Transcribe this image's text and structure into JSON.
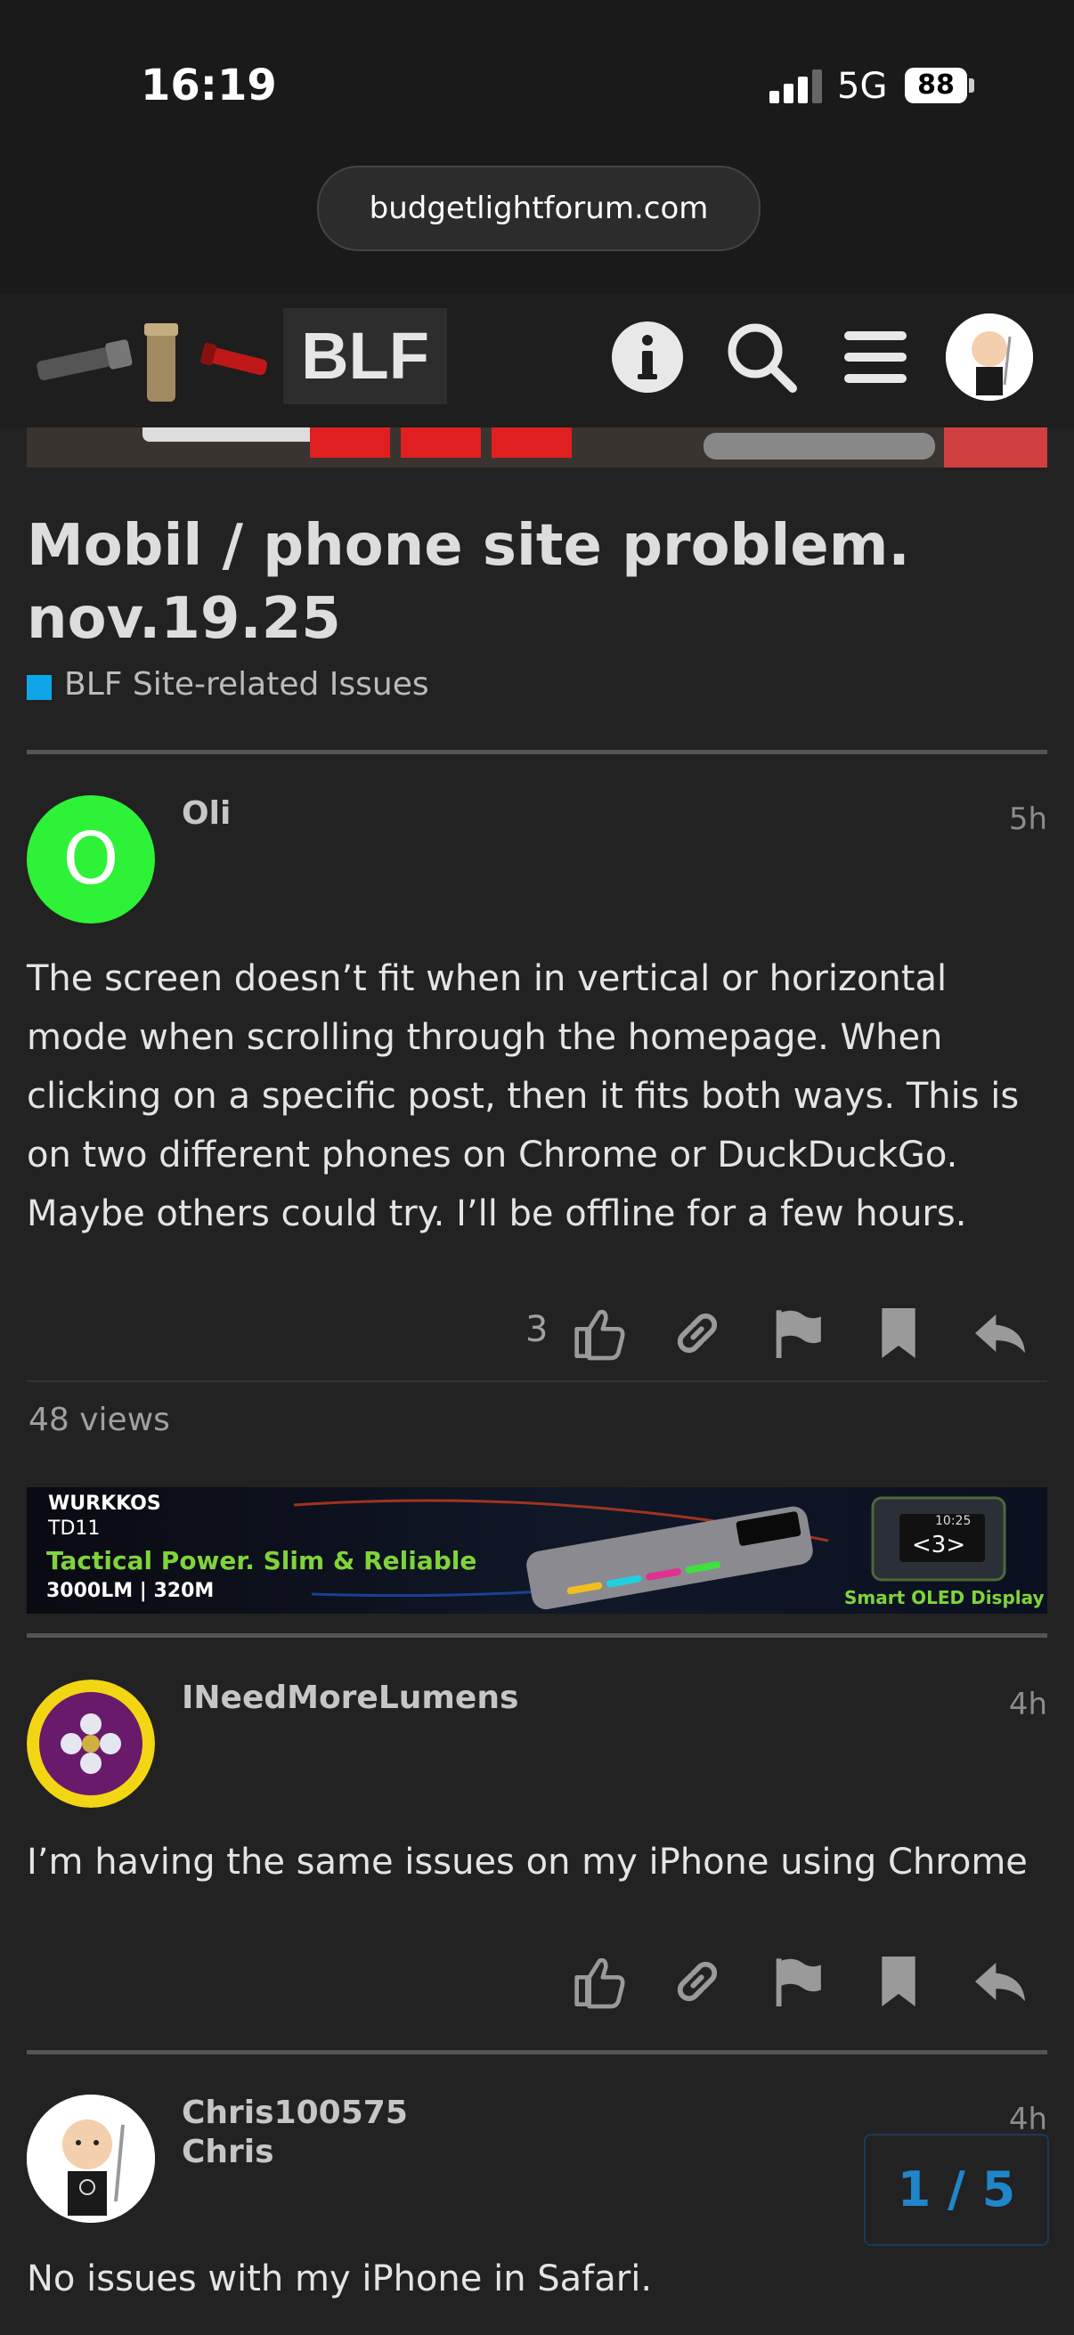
{
  "status_bar": {
    "time": "16:19",
    "network": "5G",
    "battery": "88"
  },
  "browser": {
    "url": "budgetlightforum.com"
  },
  "header": {
    "logo_text": "BLF"
  },
  "topic": {
    "title": "Mobil / phone site problem. nov.19.25",
    "category": "BLF Site-related Issues",
    "category_color": "#0ea5e9"
  },
  "posts": [
    {
      "avatar_letter": "O",
      "avatar_color": "#2ef237",
      "username": "Oli",
      "time": "5h",
      "body": "The screen doesn’t fit when in vertical or horizontal mode when scrolling through the homepage. When clicking on a specific post, then it fits both ways. This is on two different phones on Chrome or DuckDuckGo. Maybe others could try. I’ll be offline for a few hours.",
      "likes": "3"
    },
    {
      "username": "INeedMoreLumens",
      "time": "4h",
      "body": "I’m having the same issues on my iPhone using Chrome"
    },
    {
      "username": "Chris100575",
      "display_name": "Chris",
      "time": "4h",
      "body": "No issues with my iPhone in Safari."
    }
  ],
  "views": "48 views",
  "ad": {
    "brand": "WURKKOS",
    "model": "TD11",
    "tagline": "Tactical Power. Slim & Reliable",
    "specs": "3000LM | 320M",
    "display_time": "10:25",
    "display_value": "<3>",
    "feature": "Smart OLED Display"
  },
  "progress": "1 / 5"
}
